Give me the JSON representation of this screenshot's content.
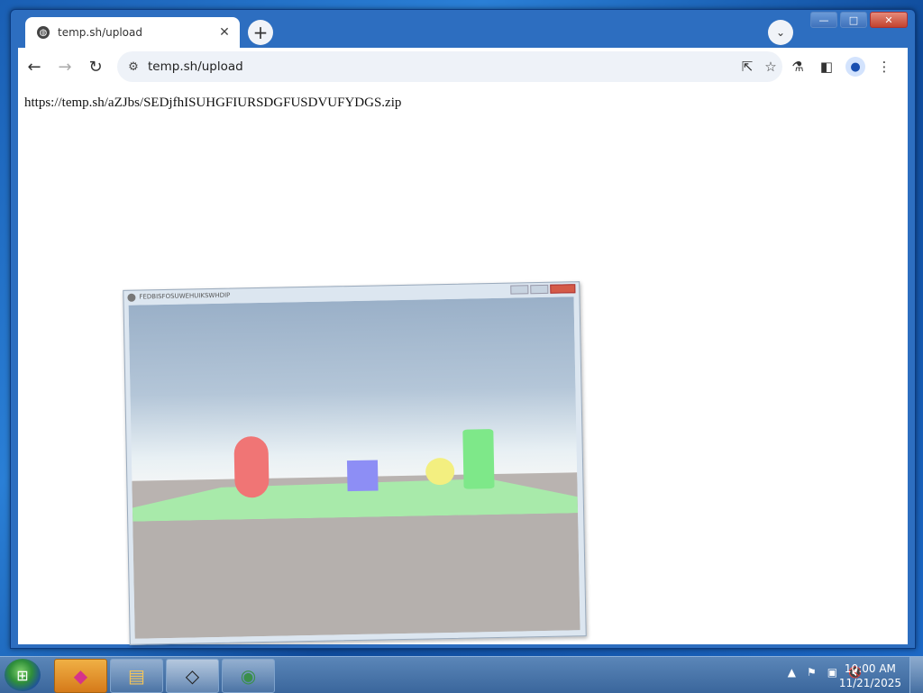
{
  "browser": {
    "tab_title": "temp.sh/upload",
    "address": "temp.sh/upload",
    "new_tab_symbol": "+",
    "window_controls": {
      "minimize": "—",
      "maximize": "□",
      "close": "✕"
    }
  },
  "page": {
    "link_text": "https://temp.sh/aZJbs/SEDjfhISUHGFIURSDGFUSDVUFYDGS.zip"
  },
  "game_window": {
    "title": "FEDBISFOSUWEHUIKSWHDIP",
    "scene_objects": [
      "red-capsule",
      "blue-cube",
      "yellow-sphere",
      "green-cylinder",
      "green-plane"
    ],
    "colors": {
      "capsule": "#f07575",
      "cube": "#8d8ef5",
      "sphere": "#f3ef80",
      "cylinder": "#7ee889",
      "plane": "#a8eaaa"
    }
  },
  "taskbar": {
    "apps": [
      "gem-app",
      "file-explorer",
      "unity",
      "chrome"
    ],
    "time": "10:00 AM",
    "date": "11/21/2025"
  }
}
